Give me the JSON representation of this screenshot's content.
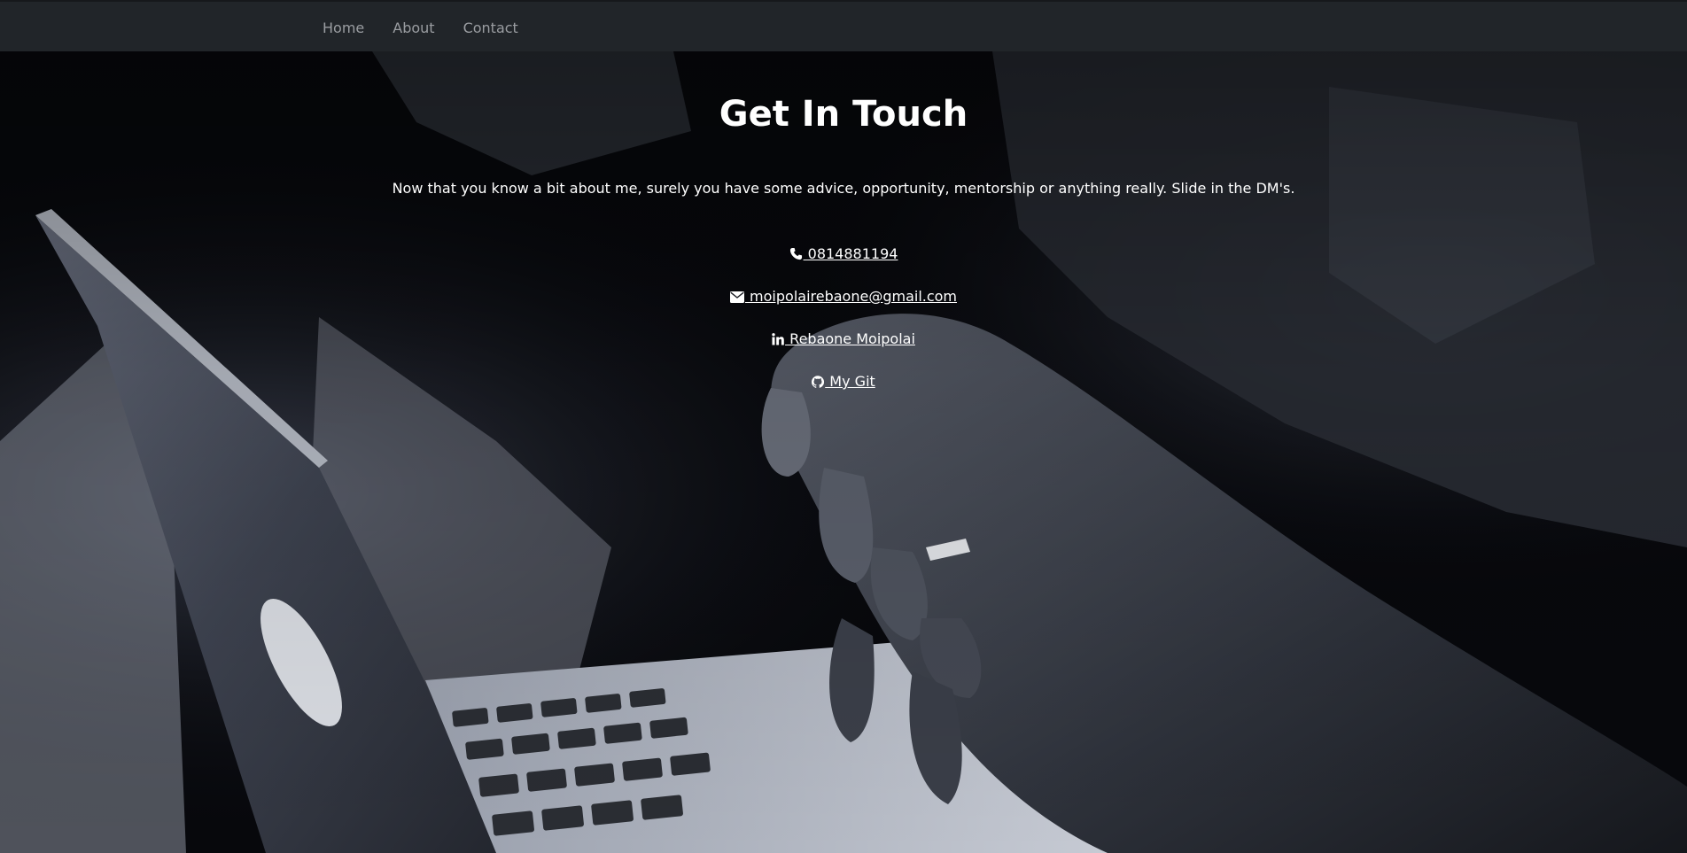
{
  "nav": {
    "items": [
      {
        "label": "Home"
      },
      {
        "label": "About"
      },
      {
        "label": "Contact"
      }
    ]
  },
  "hero": {
    "title": "Get In Touch",
    "intro": "Now that you know a bit about me, surely you have some advice, opportunity, mentorship or anything really. Slide in the DM's.",
    "background_image": "grayscale photo of hands typing on a laptop"
  },
  "contacts": {
    "phone": {
      "label": " 0814881194",
      "icon": "phone-icon"
    },
    "email": {
      "label": " moipolairebaone@gmail.com",
      "icon": "envelope-icon"
    },
    "linkedin": {
      "label": " Rebaone Moipolai",
      "icon": "linkedin-icon"
    },
    "github": {
      "label": " My Git",
      "icon": "github-icon"
    }
  },
  "colors": {
    "navbar_bg": "#212529",
    "nav_text": "#9a9da1",
    "hero_text": "#ffffff"
  }
}
